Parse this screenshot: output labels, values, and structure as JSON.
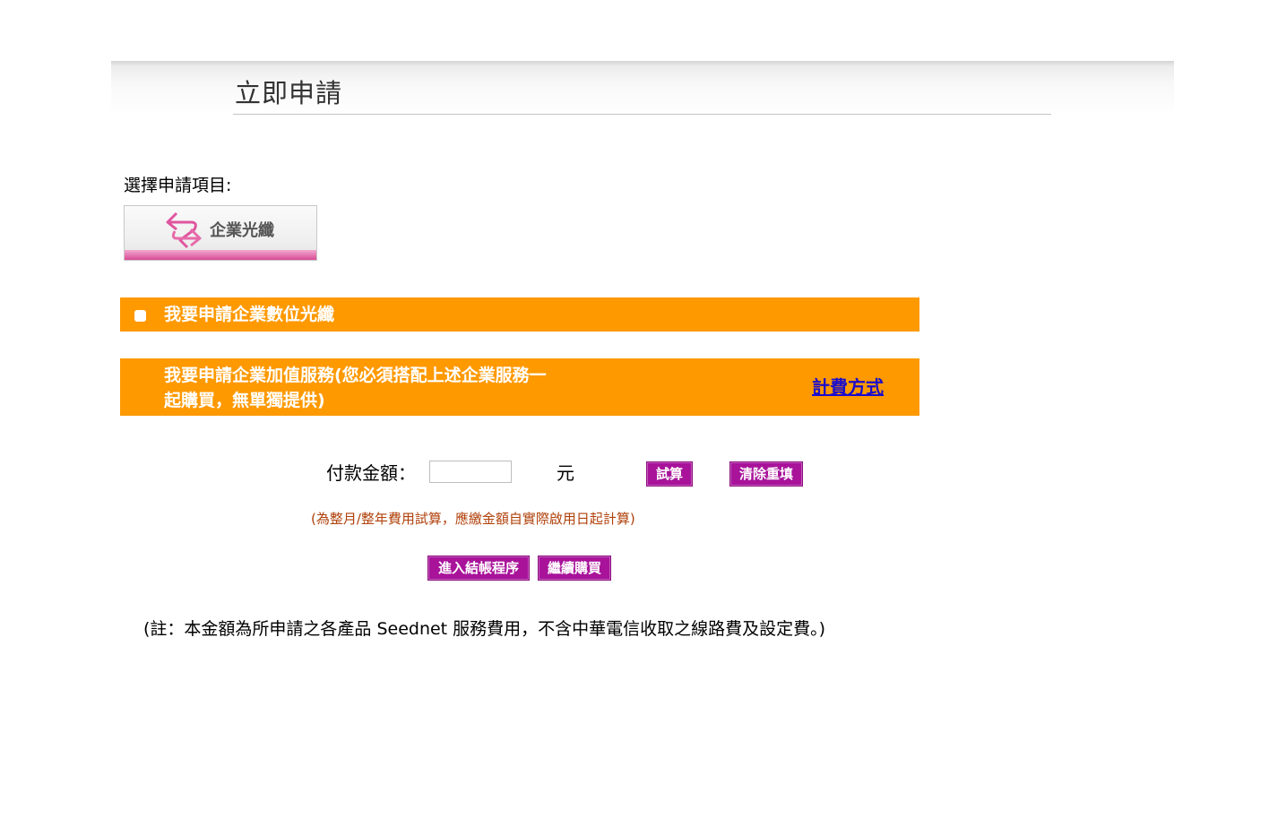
{
  "header": {
    "title": "立即申請"
  },
  "select_section": {
    "label": "選擇申請項目:",
    "product": {
      "label": "企業光纖",
      "icon": "fiber-arrows-icon",
      "accent_color": "#d84a95"
    }
  },
  "options": {
    "fiber": {
      "label": "我要申請企業數位光纖",
      "checked": false
    },
    "value_added": {
      "line1": "我要申請企業加值服務(您必須搭配上述企業服務一",
      "line2": "起購買，無單獨提供)",
      "link": "計費方式"
    },
    "bar_color": "#ff9900"
  },
  "payment": {
    "label": "付款金額：",
    "amount_value": "",
    "unit": "元",
    "calc_button": "試算",
    "clear_button": "清除重填",
    "note": "(為整月/整年費用試算，應繳金額自實際啟用日起計算)"
  },
  "actions": {
    "checkout_button": "進入結帳程序",
    "continue_button": "繼續購買",
    "button_color": "#a8139a"
  },
  "footnote": "(註：本金額為所申請之各產品 Seednet 服務費用，不含中華電信收取之線路費及設定費。)"
}
